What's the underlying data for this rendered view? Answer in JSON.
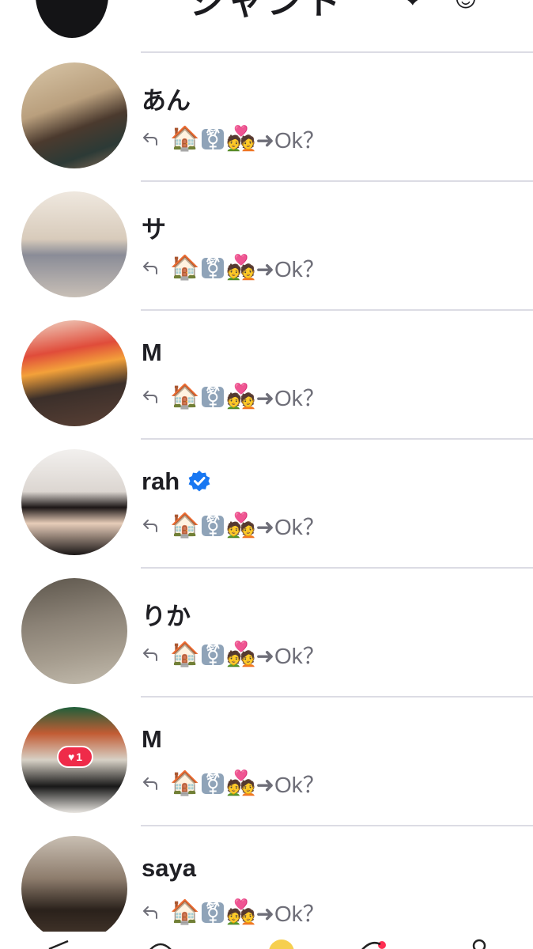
{
  "top_row": {
    "title": "ジャンド",
    "icons": [
      "heart-icon",
      "sticker-icon"
    ]
  },
  "rows": [
    {
      "name": "あん",
      "verified": false,
      "like_count": null
    },
    {
      "name": "サ",
      "verified": false,
      "like_count": null
    },
    {
      "name": "M",
      "verified": false,
      "like_count": null
    },
    {
      "name": "rah",
      "verified": true,
      "like_count": null
    },
    {
      "name": "りか",
      "verified": false,
      "like_count": null
    },
    {
      "name": "M",
      "verified": false,
      "like_count": "1"
    },
    {
      "name": "saya",
      "verified": false,
      "like_count": null
    }
  ],
  "preview": {
    "emoji_house": "🏠",
    "emoji_symbol": "⚧",
    "emoji_couple": "💑",
    "text": "➜Ok？"
  },
  "colors": {
    "divider": "#dcdce4",
    "verified": "#1877f2",
    "like_badge": "#ef2b49",
    "preview_text": "#6e6e78"
  }
}
